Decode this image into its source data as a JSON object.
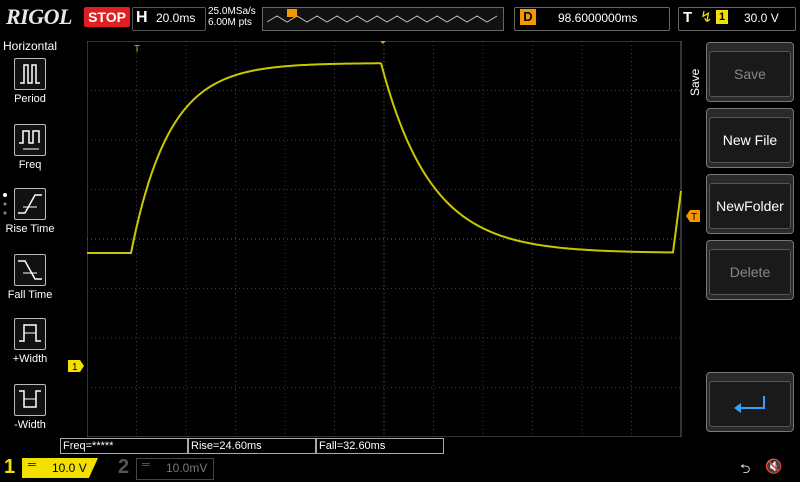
{
  "app": {
    "brand": "RIGOL",
    "run_state": "STOP"
  },
  "horizontal": {
    "label": "H",
    "timebase": "20.0ms",
    "sample_rate": "25.0MSa/s",
    "memory_depth": "6.00M pts"
  },
  "delay": {
    "label": "D",
    "value": "98.6000000ms"
  },
  "trigger": {
    "label": "T",
    "edge_icon": "rising-edge-icon",
    "source": "1",
    "level": "30.0 V"
  },
  "left_menu": {
    "title": "Horizontal",
    "items": [
      {
        "label": "Period",
        "icon": "period-icon"
      },
      {
        "label": "Freq",
        "icon": "frequency-icon"
      },
      {
        "label": "Rise Time",
        "icon": "rise-time-icon"
      },
      {
        "label": "Fall Time",
        "icon": "fall-time-icon"
      },
      {
        "label": "+Width",
        "icon": "positive-width-icon"
      },
      {
        "label": "-Width",
        "icon": "negative-width-icon"
      }
    ]
  },
  "right_menu": {
    "title": "Save",
    "buttons": [
      {
        "label": "Save",
        "enabled": false
      },
      {
        "label": "New File",
        "enabled": true
      },
      {
        "label": "NewFolder",
        "enabled": true
      },
      {
        "label": "Delete",
        "enabled": false
      },
      {
        "label": "",
        "icon": "return-arrow-icon",
        "enabled": true
      }
    ]
  },
  "markers": {
    "trigger_pos": "T",
    "ch1_offset": "1",
    "trig_level": "T"
  },
  "measurements": {
    "freq": "Freq=*****",
    "rise": "Rise=24.60ms",
    "fall": "Fall=32.60ms"
  },
  "channels": {
    "ch1": {
      "number": "1",
      "scale": "10.0 V",
      "coupling_icon": "dc-coupling-icon",
      "color": "#f3e000"
    },
    "ch2": {
      "number": "2",
      "scale": "10.0mV",
      "coupling_icon": "dc-coupling-icon",
      "color": "#555555"
    }
  },
  "status_icons": {
    "usb": "usb-icon",
    "mute": "mute-icon"
  },
  "colors": {
    "trace": "#c8c800",
    "stop": "#e02020",
    "marker": "#f39800"
  }
}
